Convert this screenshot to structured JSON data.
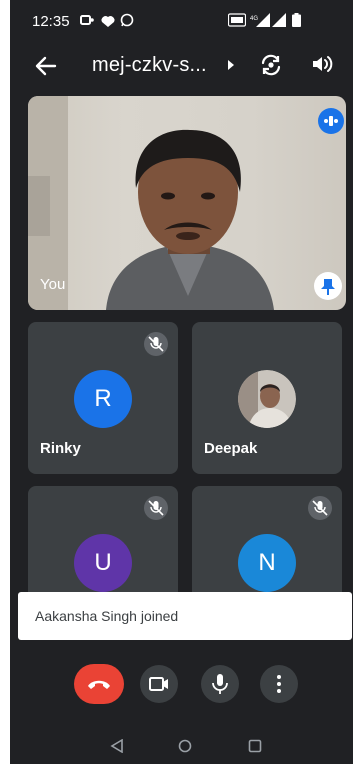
{
  "status_bar": {
    "time": "12:35"
  },
  "top_bar": {
    "meeting_code": "mej-czkv-s..."
  },
  "self_tile": {
    "name": "You"
  },
  "participants": [
    {
      "name": "Rinky",
      "initial": "R",
      "color": "#1a73e8"
    },
    {
      "name": "Deepak"
    },
    {
      "initial": "U",
      "color": "#5f35a8"
    },
    {
      "initial": "N",
      "color": "#1a88d8"
    }
  ],
  "toast": {
    "message": "Aakansha Singh joined"
  },
  "colors": {
    "background": "#202124",
    "tile": "#3c4043",
    "end_call": "#ea4335",
    "accent": "#1a73e8"
  }
}
